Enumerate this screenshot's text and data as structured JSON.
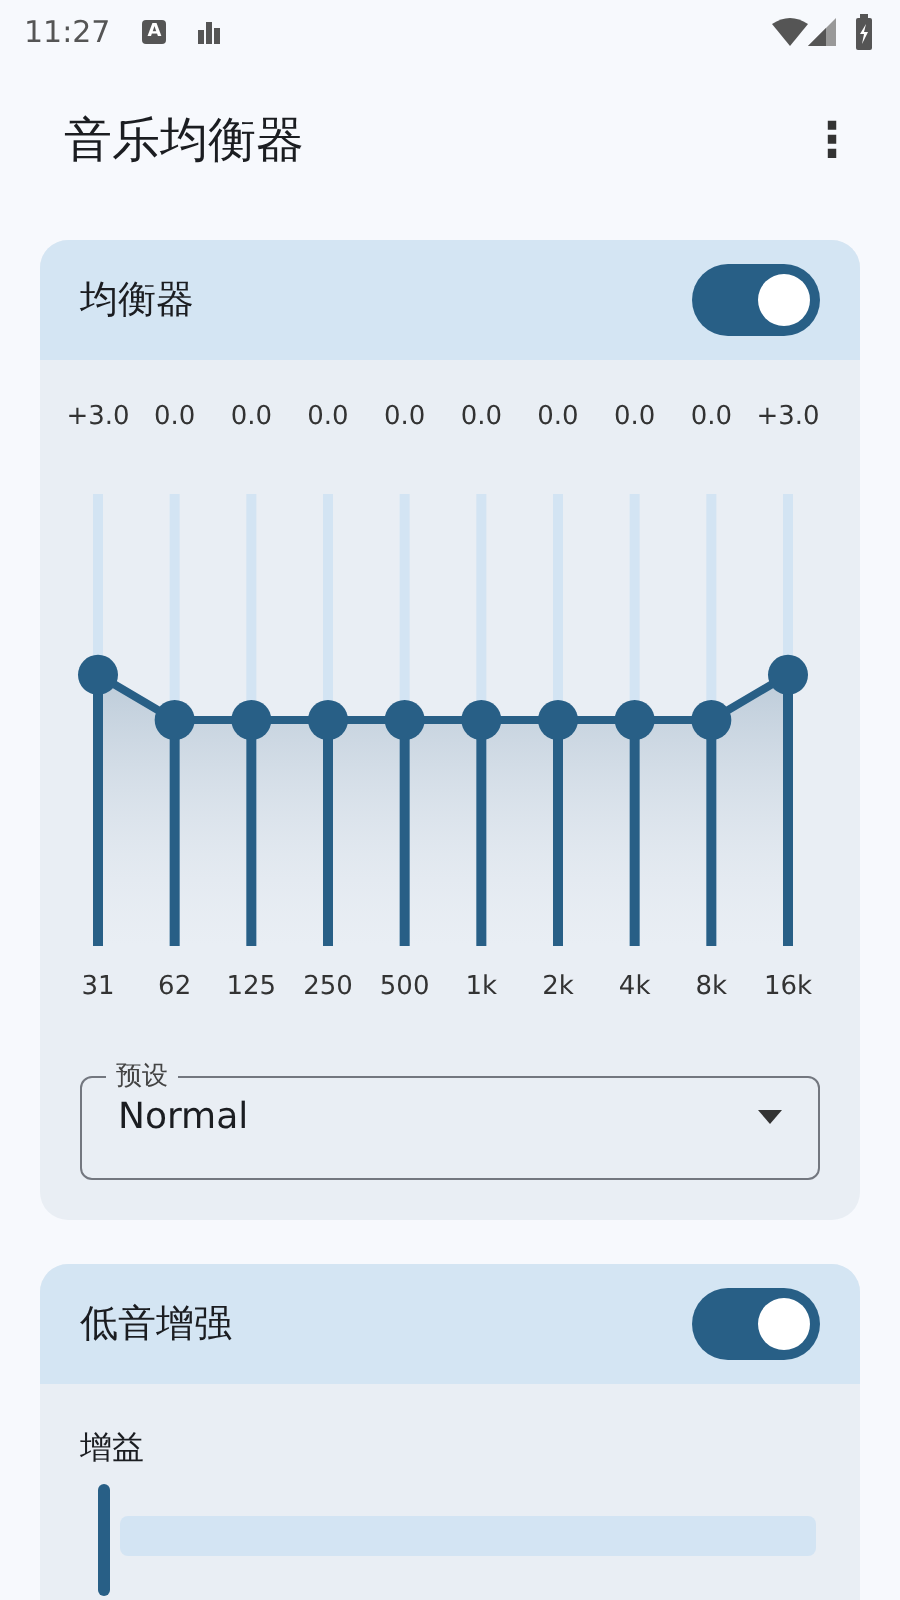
{
  "status_bar": {
    "time": "11:27",
    "app_badge": "A"
  },
  "app_bar": {
    "title": "音乐均衡器",
    "menu": "⋮"
  },
  "equalizer": {
    "title": "均衡器",
    "enabled": true,
    "bands": [
      {
        "value": "+3.0",
        "frequency": "31",
        "level": 0.6
      },
      {
        "value": "0.0",
        "frequency": "62",
        "level": 0.5
      },
      {
        "value": "0.0",
        "frequency": "125",
        "level": 0.5
      },
      {
        "value": "0.0",
        "frequency": "250",
        "level": 0.5
      },
      {
        "value": "0.0",
        "frequency": "500",
        "level": 0.5
      },
      {
        "value": "0.0",
        "frequency": "1k",
        "level": 0.5
      },
      {
        "value": "0.0",
        "frequency": "2k",
        "level": 0.5
      },
      {
        "value": "0.0",
        "frequency": "4k",
        "level": 0.5
      },
      {
        "value": "0.0",
        "frequency": "8k",
        "level": 0.5
      },
      {
        "value": "+3.0",
        "frequency": "16k",
        "level": 0.6
      }
    ],
    "preset": {
      "label": "预设",
      "value": "Normal"
    }
  },
  "bass_boost": {
    "title": "低音增强",
    "enabled": true,
    "gain_label": "增益",
    "level": 0
  }
}
